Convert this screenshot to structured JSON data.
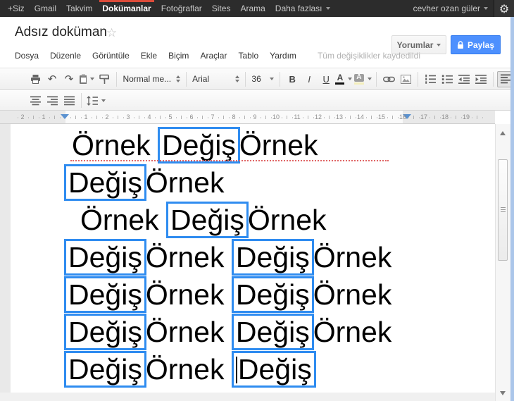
{
  "topbar": {
    "items": [
      "+Siz",
      "Gmail",
      "Takvim",
      "Dokümanlar",
      "Fotoğraflar",
      "Sites",
      "Arama",
      "Daha fazlası"
    ],
    "active_item": "Dokümanlar",
    "user_name": "cevher ozan güler",
    "gear_icon": "⚙",
    "accent_red": "#dd4b39"
  },
  "header": {
    "title": "Adsız doküman",
    "star_icon": "☆",
    "comments_button": "Yorumlar",
    "share_button": "Paylaş",
    "share_color": "#4d90fe"
  },
  "menu": {
    "items": [
      "Dosya",
      "Düzenle",
      "Görüntüle",
      "Ekle",
      "Biçim",
      "Araçlar",
      "Tablo",
      "Yardım"
    ],
    "status": "Tüm değişiklikler kaydedildi"
  },
  "toolbar": {
    "undo_icon": "↶",
    "redo_icon": "↷",
    "style_value": "Normal me...",
    "font_value": "Arial",
    "size_value": "36",
    "bold_label": "B",
    "italic_label": "I",
    "underline_label": "U",
    "text_color_label": "A",
    "highlight_label": "A"
  },
  "ruler": {
    "left_numbers": [
      2,
      1
    ],
    "numbers": [
      1,
      2,
      3,
      4,
      5,
      6,
      7,
      8,
      9,
      10,
      11,
      12,
      13,
      14,
      15,
      16,
      17,
      18,
      19
    ]
  },
  "document": {
    "match_box_color": "#2f8cf0",
    "lines": [
      {
        "indent": 10,
        "spell_underline": true,
        "segments": [
          {
            "t": "Örnek ",
            "box": false
          },
          {
            "t": "Değiş",
            "box": true
          },
          {
            "t": "Örnek",
            "box": false
          }
        ]
      },
      {
        "indent": 0,
        "segments": [
          {
            "t": "Değiş",
            "box": true
          },
          {
            "t": "Örnek",
            "box": false
          }
        ]
      },
      {
        "indent": 22,
        "segments": [
          {
            "t": "Örnek ",
            "box": false
          },
          {
            "t": "Değiş",
            "box": true
          },
          {
            "t": "Örnek",
            "box": false
          }
        ]
      },
      {
        "indent": 0,
        "segments": [
          {
            "t": "Değiş",
            "box": true
          },
          {
            "t": "Örnek ",
            "box": false
          },
          {
            "t": "Değiş",
            "box": true
          },
          {
            "t": "Örnek",
            "box": false
          }
        ]
      },
      {
        "indent": 0,
        "segments": [
          {
            "t": "Değiş",
            "box": true
          },
          {
            "t": "Örnek ",
            "box": false
          },
          {
            "t": "Değiş",
            "box": true
          },
          {
            "t": "Örnek",
            "box": false
          }
        ]
      },
      {
        "indent": 0,
        "segments": [
          {
            "t": "Değiş",
            "box": true
          },
          {
            "t": "Örnek ",
            "box": false
          },
          {
            "t": "Değiş",
            "box": true
          },
          {
            "t": "Örnek",
            "box": false
          }
        ]
      },
      {
        "indent": 0,
        "segments": [
          {
            "t": "Değiş",
            "box": true
          },
          {
            "t": "Örnek ",
            "box": false
          },
          {
            "t": "Değiş",
            "box": true,
            "caret": true
          }
        ]
      }
    ]
  }
}
